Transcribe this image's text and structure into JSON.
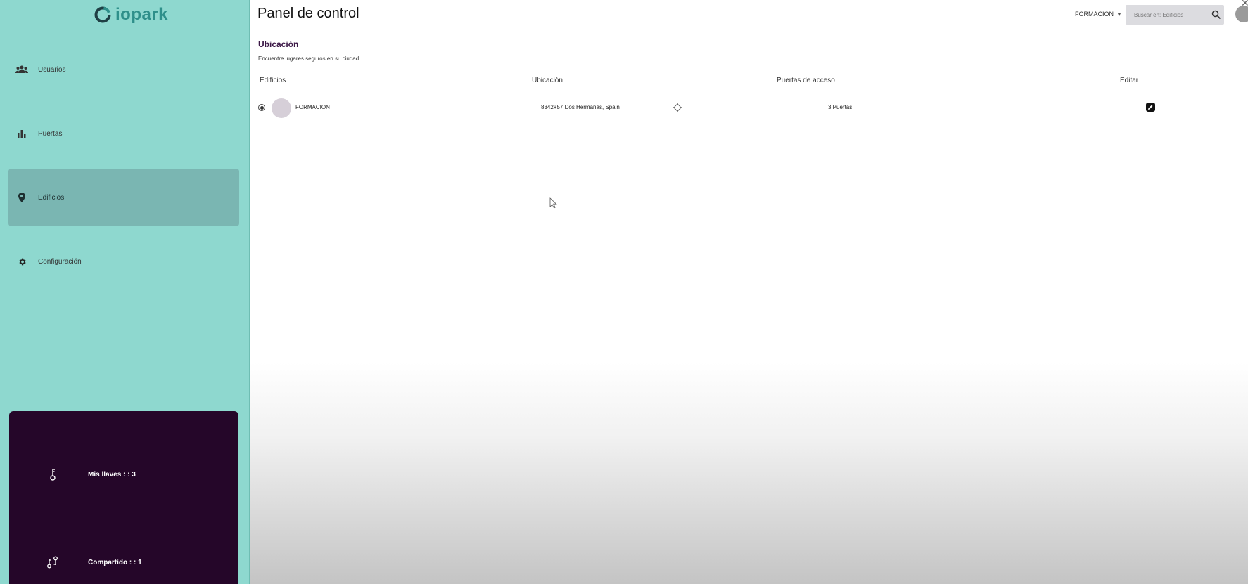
{
  "brand": {
    "name": "iopark",
    "color": "#2e8f8a"
  },
  "sidebar": {
    "background": "#8ed8cf",
    "items": [
      {
        "label": "Usuarios",
        "icon": "users-icon",
        "active": false
      },
      {
        "label": "Puertas",
        "icon": "bar-chart-icon",
        "active": false
      },
      {
        "label": "Edificios",
        "icon": "location-pin-icon",
        "active": true
      },
      {
        "label": "Configuración",
        "icon": "gear-icon",
        "active": false
      }
    ],
    "keys_panel": {
      "background": "#250629",
      "items": [
        {
          "label": "Mis llaves : : 3",
          "icon": "key-icon"
        },
        {
          "label": "Compartido : : 1",
          "icon": "shared-keys-icon"
        }
      ]
    }
  },
  "header": {
    "title": "Panel de control",
    "tenant": "FORMACION",
    "search_placeholder": "Buscar en: Edificios"
  },
  "section": {
    "title": "Ubicación",
    "subtitle": "Encuentre lugares seguros en su ciudad."
  },
  "table": {
    "columns": [
      "Edificios",
      "Ubicación",
      "Puertas de acceso",
      "Editar"
    ],
    "rows": [
      {
        "selected": true,
        "building": "FORMACION",
        "location": "8342+57 Dos Hermanas, Spain",
        "doors": "3 Puertas"
      }
    ]
  }
}
